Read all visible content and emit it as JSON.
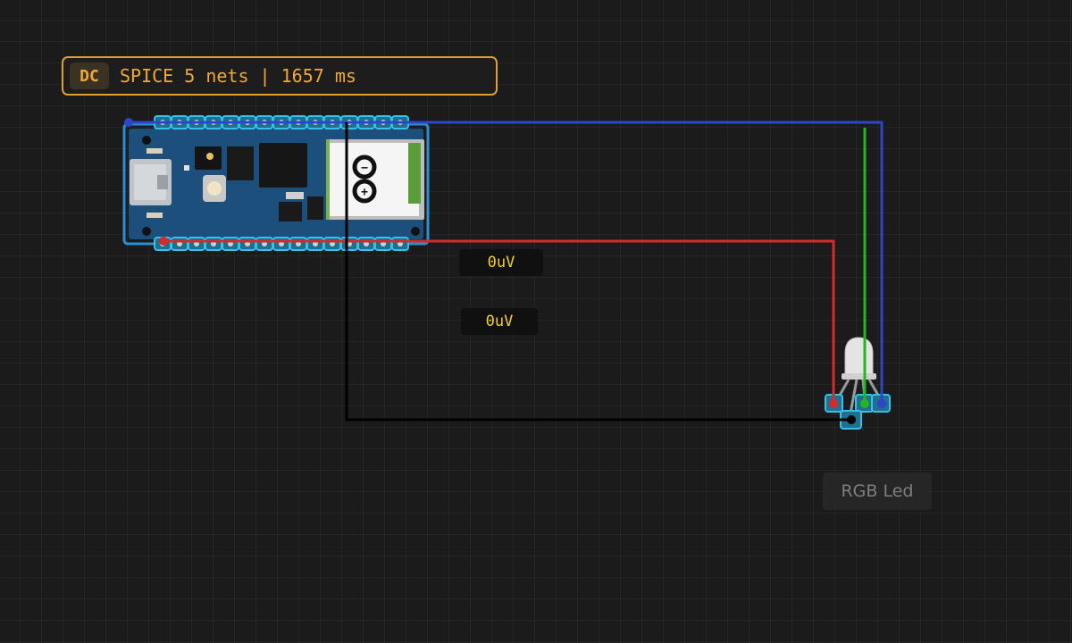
{
  "simulation": {
    "mode_badge": "DC",
    "status_text": "SPICE 5 nets | 1657 ms"
  },
  "probes": [
    {
      "reading": "0uV"
    },
    {
      "reading": "0uV"
    }
  ],
  "components": {
    "board": {
      "logo_symbols": [
        "−",
        "+"
      ]
    },
    "rgb_led": {
      "label": "RGB Led"
    }
  },
  "wires": [
    {
      "color": "#2b46c8"
    },
    {
      "color": "#d42a2a"
    },
    {
      "color": "#23b523"
    },
    {
      "color": "#000000"
    }
  ],
  "colors": {
    "accent": "#e0a030",
    "probe_text": "#f2d21a",
    "pin_highlight": "#35c2ea",
    "board_blue": "#1d4f7c"
  }
}
